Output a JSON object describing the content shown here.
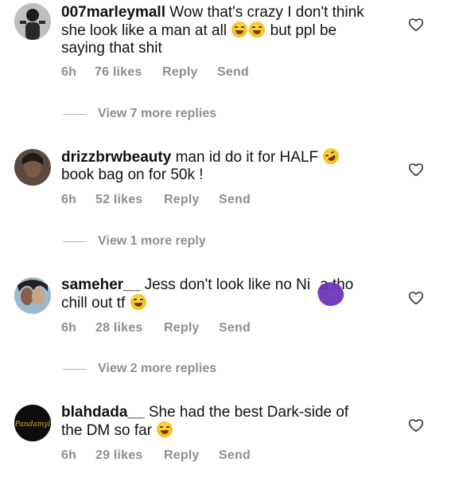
{
  "comments": [
    {
      "username": "007marleymall",
      "line1": "Wow that's crazy I don't think",
      "line2_a": "she look like a man at all",
      "line2_b": "but ppl be",
      "line3": "saying that shit",
      "time": "6h",
      "likes": "76 likes",
      "reply": "Reply",
      "send": "Send",
      "view_more": "View 7 more replies"
    },
    {
      "username": "drizzbrwbeauty",
      "line1": "man id do it for HALF",
      "line2": "book bag on for 50k !",
      "time": "6h",
      "likes": "52 likes",
      "reply": "Reply",
      "send": "Send",
      "view_more": "View 1 more reply"
    },
    {
      "username": "sameher__",
      "line1_a": "Jess don't look like no Ni",
      "line1_b": "a tho",
      "line2": "chill out tf",
      "time": "6h",
      "likes": "28 likes",
      "reply": "Reply",
      "send": "Send",
      "view_more": "View 2 more replies"
    },
    {
      "username": "blahdada__",
      "line1": "She had the best Dark-side of",
      "line2": "the DM so far",
      "avatar_text": "Pandamyl",
      "time": "6h",
      "likes": "29 likes",
      "reply": "Reply",
      "send": "Send"
    }
  ],
  "icons": {
    "like": "heart-outline-icon",
    "emoji_laugh": "tears-of-joy-emoji",
    "emoji_rofl": "rolling-on-floor-laughing-emoji"
  },
  "colors": {
    "text": "#111111",
    "meta": "#8e8e8e",
    "censor": "#6a2fb8"
  }
}
